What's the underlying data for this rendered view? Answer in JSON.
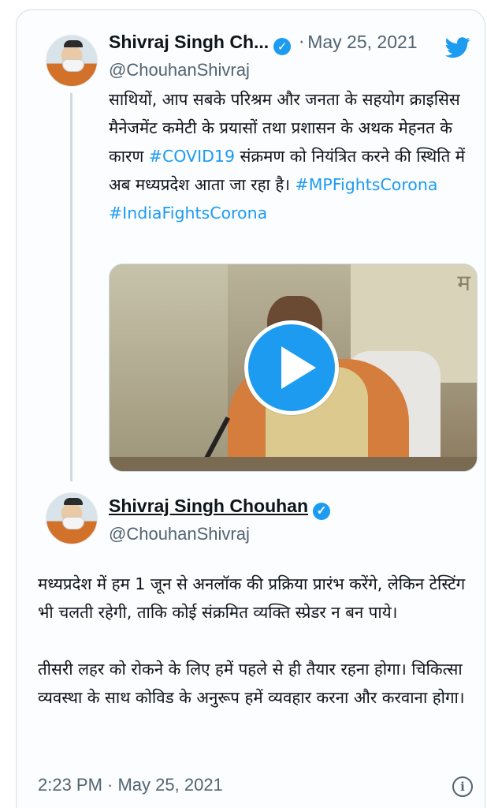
{
  "parent_tweet": {
    "name": "Shivraj Singh Ch...",
    "verified_icon": "verified-badge-icon",
    "separator": "·",
    "date": "May 25, 2021",
    "handle": "@ChouhanShivraj",
    "text_parts": [
      "साथियों, आप सबके परिश्रम और जनता के सहयोग क्राइसिस मैनेजमेंट कमेटी के प्रयासों तथा प्रशासन के अथक मेहनत के कारण ",
      "#COVID19",
      " संक्रमण को नियंत्रित करने की स्थिति में अब मध्यप्रदेश आता जा रहा है। ",
      "#MPFightsCorona",
      " ",
      "#IndiaFightsCorona"
    ],
    "video_overlay_text": "म",
    "media": {
      "type": "video",
      "play_icon": "play-icon"
    }
  },
  "main_tweet": {
    "name": "Shivraj Singh Chouhan",
    "verified_icon": "verified-badge-icon",
    "handle": "@ChouhanShivraj",
    "paragraph_1": "मध्यप्रदेश में हम 1 जून से अनलॉक की प्रक्रिया प्रारंभ करेंगे, लेकिन टेस्टिंग भी चलती रहेगी, ताकि कोई संक्रमित व्यक्ति स्प्रेडर न बन पाये।",
    "paragraph_2": "तीसरी लहर को रोकने के लिए हमें पहले से ही तैयार रहना होगा। चिकित्सा व्यवस्था के साथ कोविड के अनुरूप हमें व्यवहार करना और करवाना होगा।",
    "timestamp": "2:23 PM · May 25, 2021",
    "info_icon": "info-icon",
    "info_glyph": "i"
  },
  "colors": {
    "accent": "#1d9bf0",
    "text": "#0f1419",
    "secondary": "#536471"
  },
  "brand_icon": "twitter-bird-icon"
}
